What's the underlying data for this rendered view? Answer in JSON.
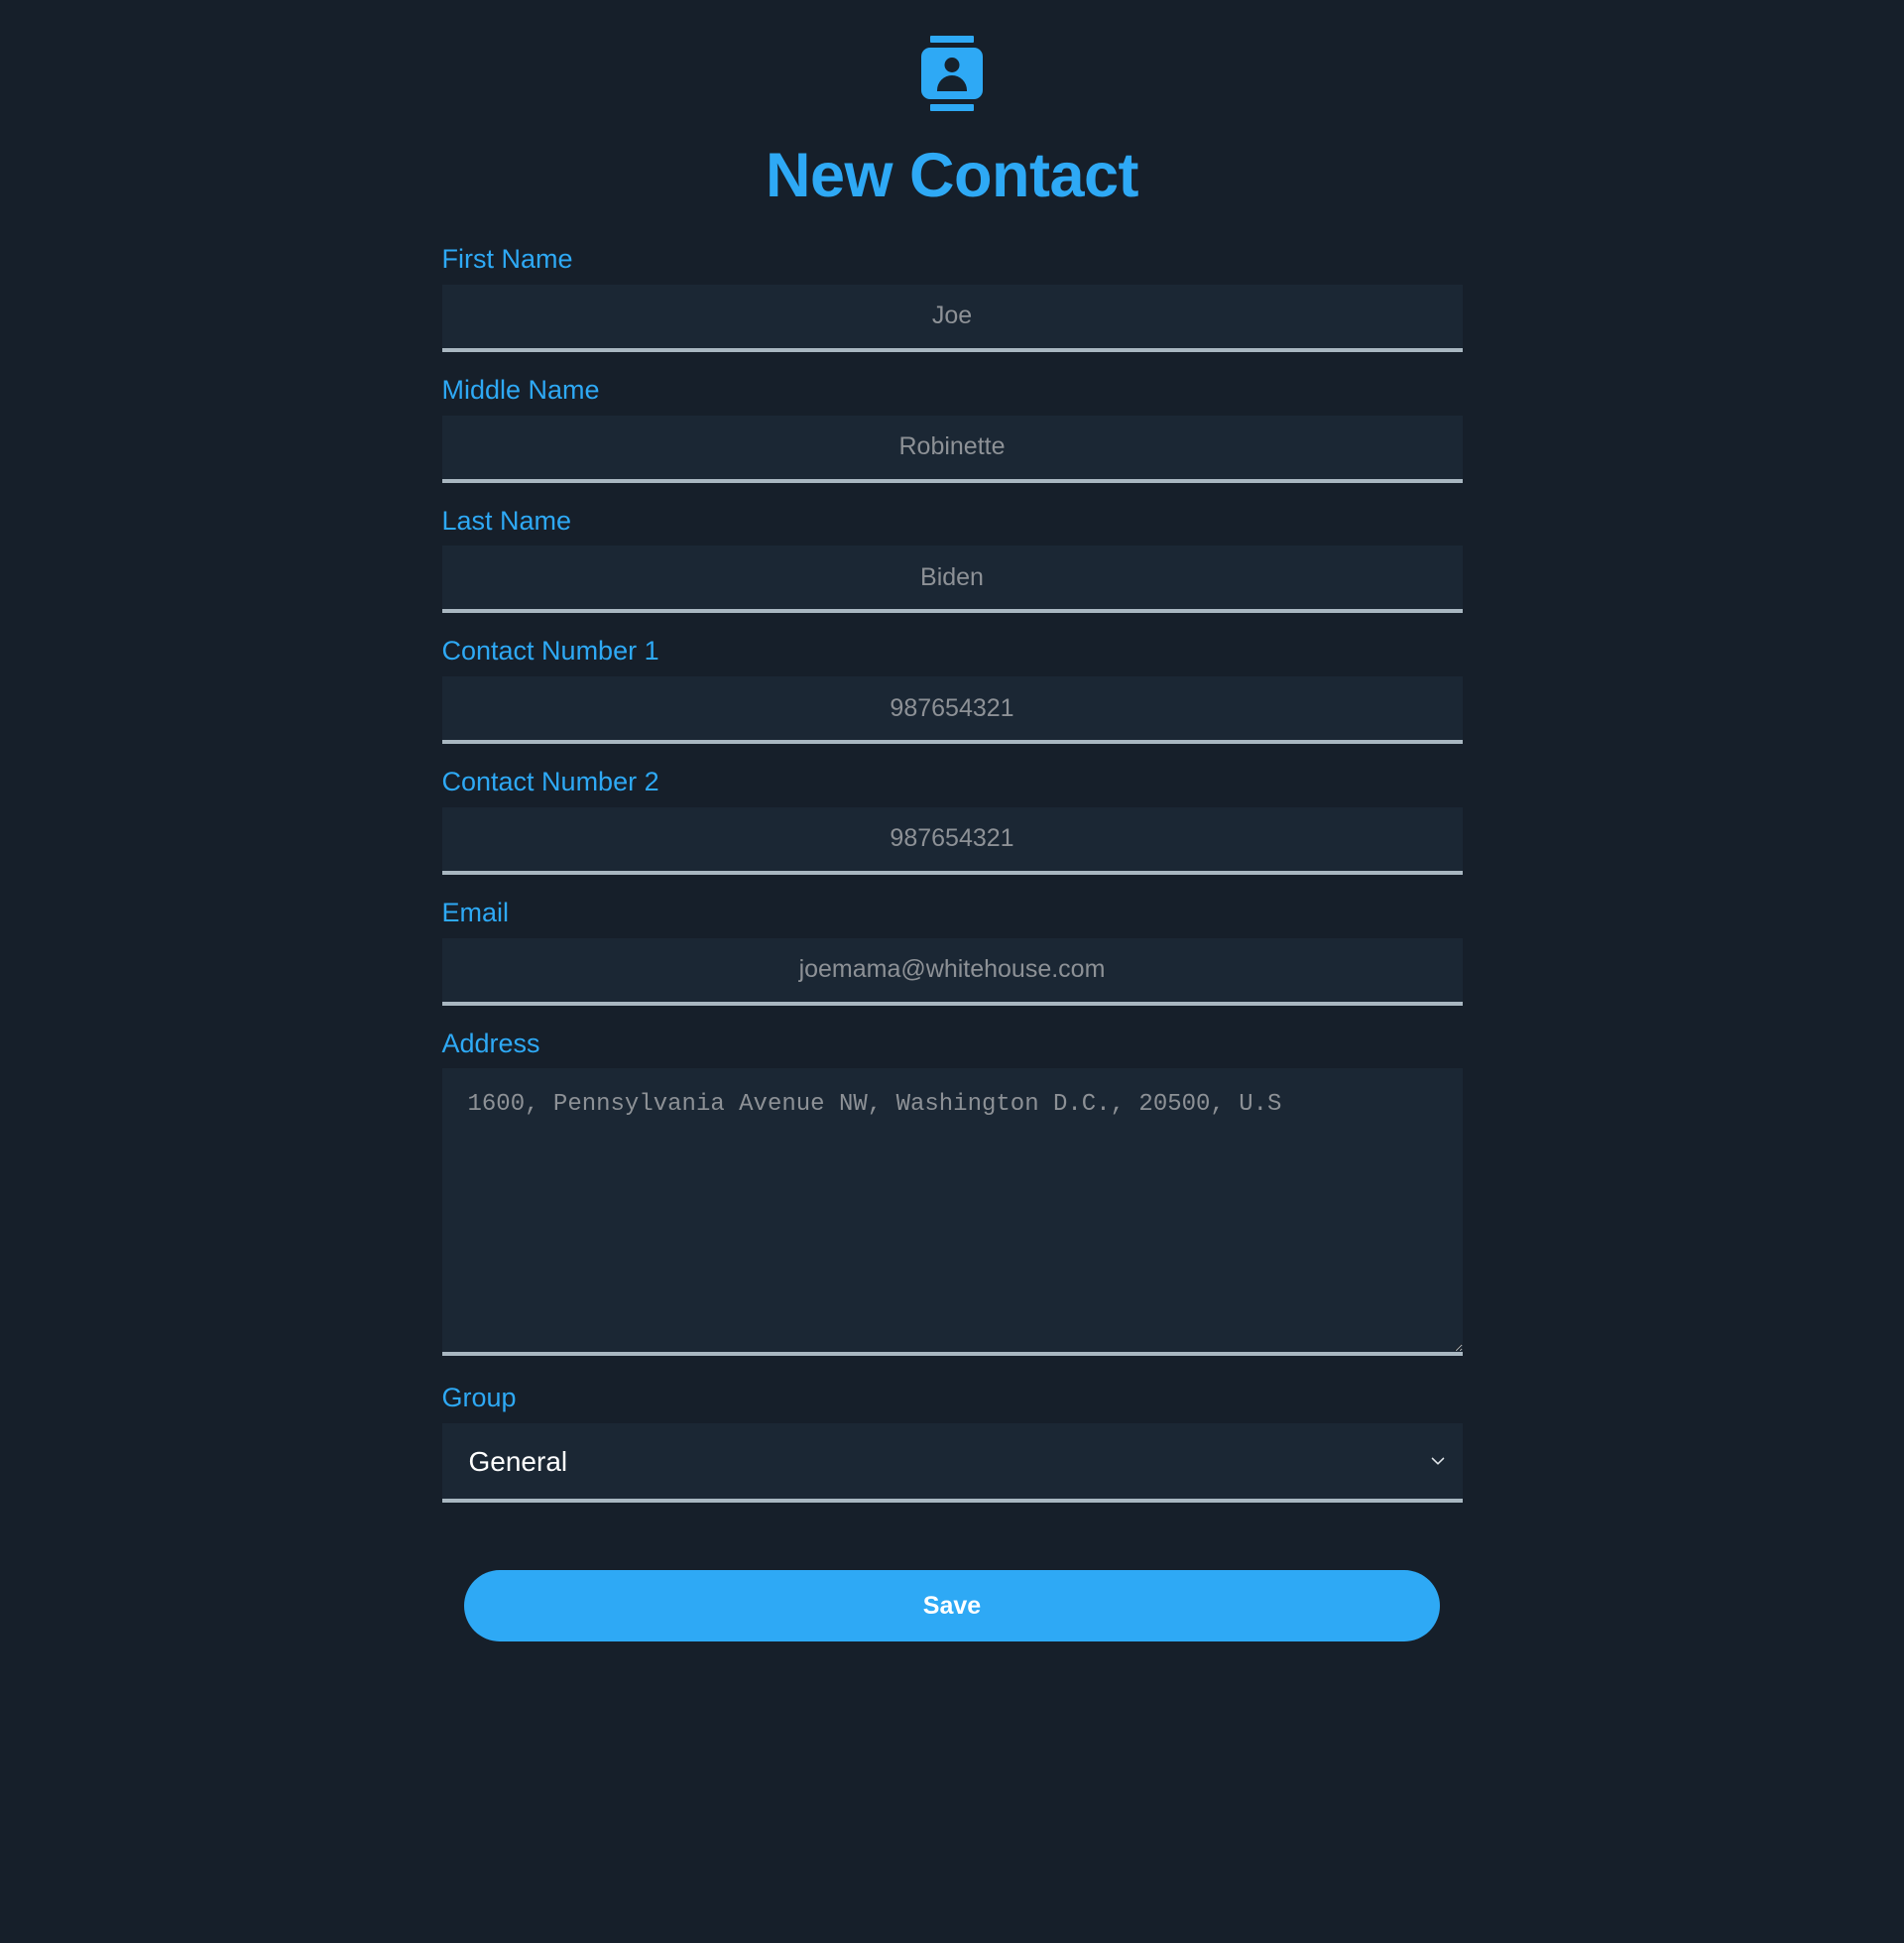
{
  "app": {
    "icon": "contact-card-icon",
    "title": "New Contact",
    "accent_color": "#2ea9f5",
    "background_color": "#161f2a",
    "field_background_color": "#1b2734",
    "underline_color": "#a9b7c1"
  },
  "form": {
    "fields": [
      {
        "label": "First Name",
        "placeholder": "Joe",
        "value": "",
        "type": "text"
      },
      {
        "label": "Middle Name",
        "placeholder": "Robinette",
        "value": "",
        "type": "text"
      },
      {
        "label": "Last Name",
        "placeholder": "Biden",
        "value": "",
        "type": "text"
      },
      {
        "label": "Contact Number 1",
        "placeholder": "987654321",
        "value": "",
        "type": "tel"
      },
      {
        "label": "Contact Number 2",
        "placeholder": "987654321",
        "value": "",
        "type": "tel"
      },
      {
        "label": "Email",
        "placeholder": "joemama@whitehouse.com",
        "value": "",
        "type": "email"
      }
    ],
    "address": {
      "label": "Address",
      "placeholder": "1600, Pennsylvania Avenue NW, Washington D.C., 20500, U.S",
      "value": ""
    },
    "group": {
      "label": "Group",
      "selected": "General",
      "options": [
        "General"
      ],
      "chevron": "chevron-down-icon"
    },
    "save_label": "Save"
  }
}
